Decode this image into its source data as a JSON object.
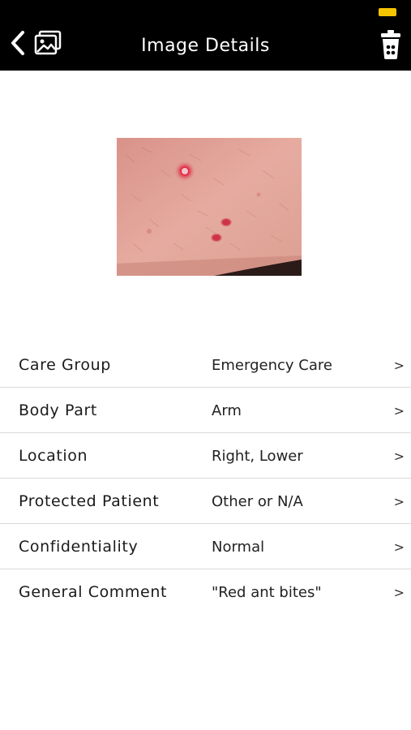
{
  "status_bar": {
    "battery_color": "#f5c400"
  },
  "header": {
    "title": "Image Details",
    "back_icon": "chevron-left-icon",
    "gallery_icon": "photo-gallery-icon",
    "delete_icon": "trash-icon",
    "background": "#000000"
  },
  "image": {
    "subject": "skin-photo-icon"
  },
  "details": [
    {
      "label": "Care Group",
      "value": "Emergency Care",
      "chevron": ">"
    },
    {
      "label": "Body Part",
      "value": "Arm",
      "chevron": ">"
    },
    {
      "label": "Location",
      "value": "Right, Lower",
      "chevron": ">"
    },
    {
      "label": "Protected Patient",
      "value": "Other or N/A",
      "chevron": ">"
    },
    {
      "label": "Confidentiality",
      "value": "Normal",
      "chevron": ">"
    },
    {
      "label": "General Comment",
      "value": "\"Red ant bites\"",
      "chevron": ">"
    }
  ]
}
